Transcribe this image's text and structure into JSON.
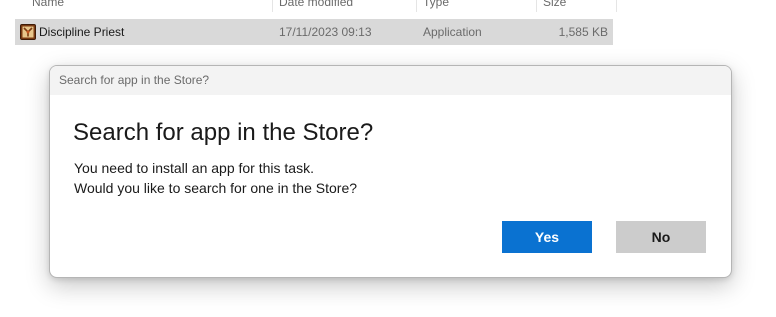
{
  "explorer": {
    "columns": {
      "name": "Name",
      "date_modified": "Date modified",
      "type": "Type",
      "size": "Size"
    },
    "file": {
      "name": "Discipline Priest",
      "date_modified": "17/11/2023 09:13",
      "type": "Application",
      "size": "1,585 KB",
      "icon": "application-icon"
    }
  },
  "dialog": {
    "window_title": "Search for app in the Store?",
    "heading": "Search for app in the Store?",
    "message_line1": "You need to install an app for this task.",
    "message_line2": "Would you like to search for one in the Store?",
    "yes_label": "Yes",
    "no_label": "No",
    "accent_color": "#0a72d1"
  }
}
